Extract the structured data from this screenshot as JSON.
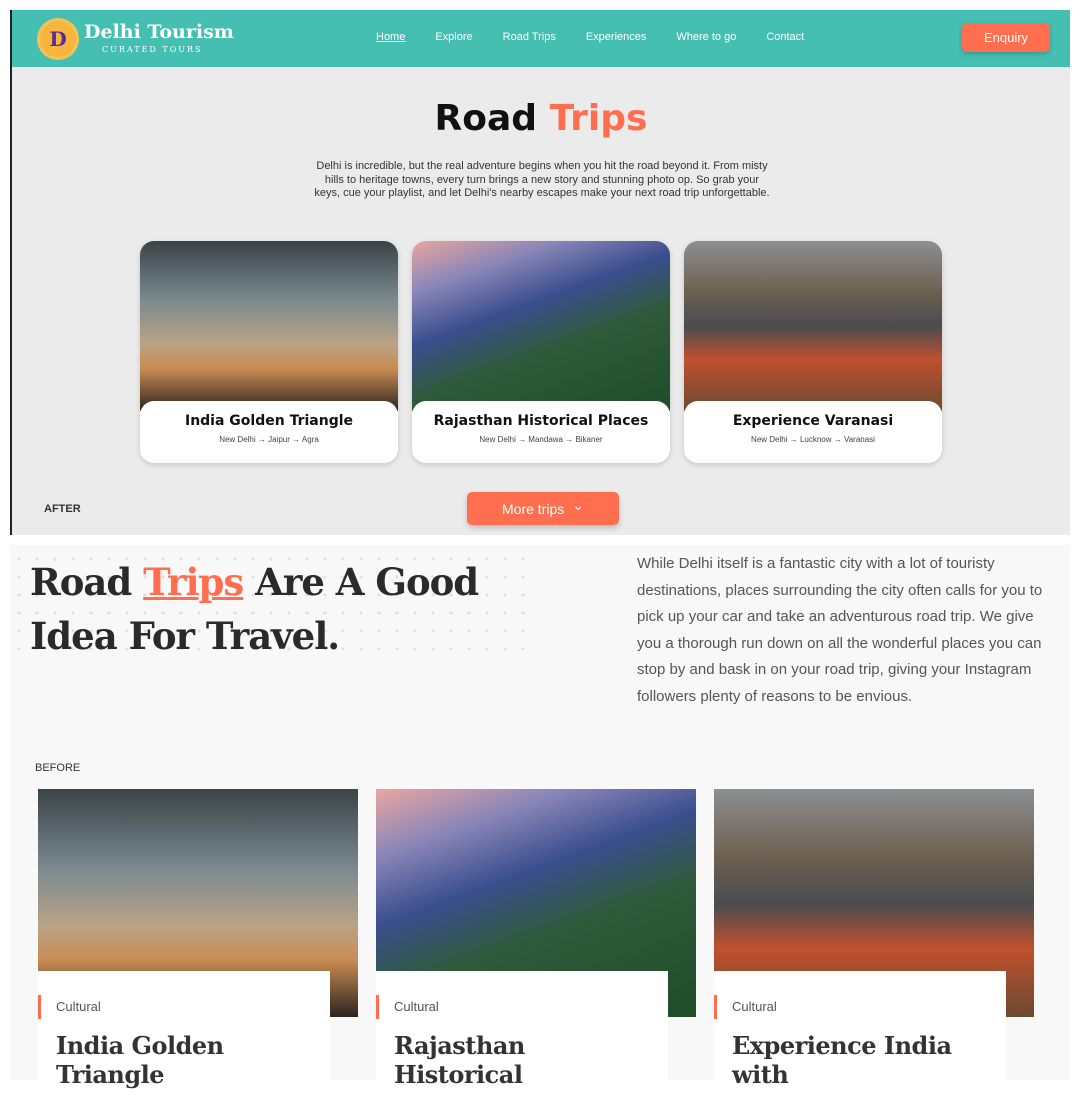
{
  "after": {
    "label": "AFTER",
    "nav": {
      "logo_letter": "D",
      "brand": "Delhi Tourism",
      "tagline": "CURATED TOURS",
      "links": [
        "Home",
        "Explore",
        "Road Trips",
        "Experiences",
        "Where to go",
        "Contact"
      ],
      "enquiry": "Enquiry"
    },
    "title_a": "Road",
    "title_b": "Trips",
    "intro": "Delhi is incredible, but the real adventure begins when you hit the road beyond it. From misty hills to heritage towns, every turn brings a new story and stunning photo op. So grab your keys, cue your playlist, and let Delhi's nearby escapes make your next road trip unforgettable.",
    "cards": [
      {
        "title": "India Golden Triangle",
        "route": "New Delhi → Jaipur → Agra"
      },
      {
        "title": "Rajasthan Historical Places",
        "route": "New Delhi → Mandawa → Bikaner"
      },
      {
        "title": "Experience Varanasi",
        "route": "New Delhi → Lucknow → Varanasi"
      }
    ],
    "more": "More trips",
    "more_icon": "⌄"
  },
  "before": {
    "label": "BEFORE",
    "h_a": "Road ",
    "h_b": "Trips",
    "h_c": " Are A Good",
    "h_d": "Idea For Travel.",
    "para": "While Delhi itself is a fantastic city with a lot of touristy destinations, places surrounding the city often calls for you to pick up your car and take an adventurous road trip. We give you a thorough run down on all the wonderful places you can stop by and bask in on your road trip, giving your Instagram followers plenty of reasons to be envious.",
    "cards": [
      {
        "tag": "Cultural",
        "title": "India Golden Triangle"
      },
      {
        "tag": "Cultural",
        "title": "Rajasthan Historical"
      },
      {
        "tag": "Cultural",
        "title": "Experience India with"
      }
    ]
  }
}
